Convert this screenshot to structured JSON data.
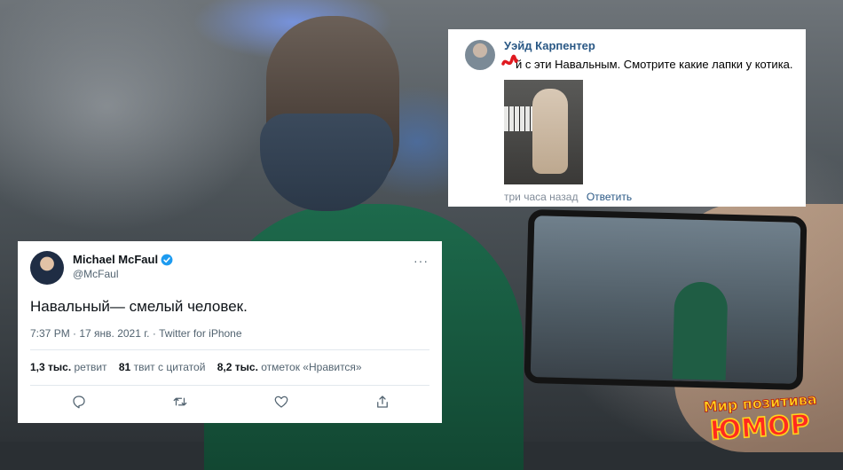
{
  "vk_comment": {
    "author": "Уэйд Карпентер",
    "text": "й с эти Навальным. Смотрите какие лапки у котика.",
    "time": "три часа назад",
    "reply_label": "Ответить"
  },
  "tweet": {
    "author_name": "Michael McFaul",
    "handle": "@McFaul",
    "more": "···",
    "text": "Навальный— смелый человек.",
    "meta": "7:37 PM · 17 янв. 2021 г. · Twitter for iPhone",
    "stats": [
      {
        "value": "1,3 тыс.",
        "label": "ретвит"
      },
      {
        "value": "81",
        "label": "твит с цитатой"
      },
      {
        "value": "8,2 тыс.",
        "label": "отметок «Нравится»"
      }
    ],
    "actions": [
      "reply-icon",
      "retweet-icon",
      "like-icon",
      "share-icon"
    ]
  },
  "watermark": {
    "line1": "Мир позитива",
    "line2": "ЮМОР"
  },
  "colors": {
    "vk_link": "#2a5885",
    "twitter_blue": "#1d9bf0",
    "gray_text": "#536471"
  }
}
